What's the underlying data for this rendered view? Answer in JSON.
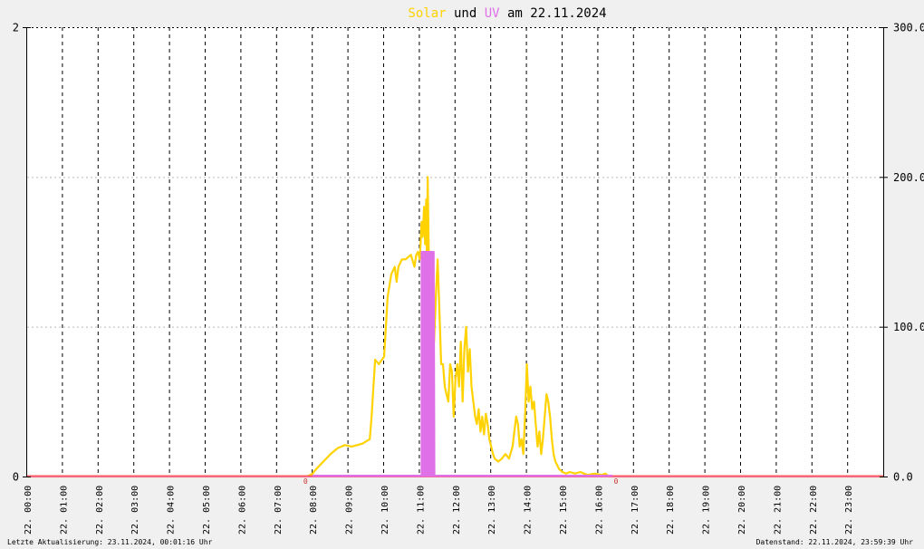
{
  "title": {
    "part1": "Solar",
    "part2": " und ",
    "part3": "UV",
    "part4": " am 22.11.2024"
  },
  "colors": {
    "solar": "#ffd200",
    "uv": "#e070e8",
    "baseline": "#ff6060",
    "title_text": "#000000",
    "background": "#f0f0f0",
    "plot_background": "#ffffff"
  },
  "footer": {
    "left": "Letzte Aktualisierung: 23.11.2024, 00:01:16 Uhr",
    "right": "Datenstand: 22.11.2024, 23:59:39 Uhr"
  },
  "chart_data": {
    "type": "line",
    "x_ticks": [
      "22. 00:00",
      "22. 01:00",
      "22. 02:00",
      "22. 03:00",
      "22. 04:00",
      "22. 05:00",
      "22. 06:00",
      "22. 07:00",
      "22. 08:00",
      "22. 09:00",
      "22. 10:00",
      "22. 11:00",
      "22. 12:00",
      "22. 13:00",
      "22. 14:00",
      "22. 15:00",
      "22. 16:00",
      "22. 17:00",
      "22. 18:00",
      "22. 19:00",
      "22. 20:00",
      "22. 21:00",
      "22. 22:00",
      "22. 23:00"
    ],
    "y_left": {
      "ticks": [
        "0",
        "2"
      ],
      "range": [
        0,
        2
      ]
    },
    "y_right": {
      "ticks": [
        "0.0",
        "100.0",
        "200.0",
        "300.0"
      ],
      "range": [
        0,
        300
      ]
    },
    "grid": true,
    "markers": [
      {
        "label": "0",
        "hour": 7.8
      },
      {
        "label": "0",
        "hour": 16.5
      }
    ],
    "series": [
      {
        "axis": "right",
        "hours": [
          0,
          7.85,
          8.0,
          8.1,
          8.3,
          8.5,
          8.7,
          8.9,
          9.1,
          9.4,
          9.6,
          9.65,
          9.75,
          9.85,
          10.0,
          10.05,
          10.1,
          10.2,
          10.3,
          10.35,
          10.4,
          10.5,
          10.6,
          10.75,
          10.85,
          10.9,
          10.95,
          11.0,
          11.05,
          11.08,
          11.12,
          11.15,
          11.18,
          11.2,
          11.22,
          11.25,
          11.28,
          11.3,
          11.32,
          11.35,
          11.4,
          11.45,
          11.5,
          11.55,
          11.6,
          11.65,
          11.7,
          11.75,
          11.8,
          11.85,
          11.9,
          11.95,
          12.0,
          12.05,
          12.1,
          12.15,
          12.2,
          12.25,
          12.3,
          12.35,
          12.4,
          12.45,
          12.5,
          12.55,
          12.6,
          12.65,
          12.7,
          12.75,
          12.8,
          12.85,
          12.9,
          12.95,
          13.0,
          13.05,
          13.1,
          13.2,
          13.3,
          13.4,
          13.5,
          13.6,
          13.65,
          13.7,
          13.75,
          13.8,
          13.85,
          13.9,
          13.95,
          14.0,
          14.05,
          14.1,
          14.15,
          14.2,
          14.25,
          14.3,
          14.35,
          14.4,
          14.45,
          14.5,
          14.55,
          14.6,
          14.65,
          14.7,
          14.75,
          14.8,
          14.9,
          15.0,
          15.1,
          15.2,
          15.35,
          15.5,
          15.7,
          15.9,
          16.1,
          16.2,
          16.3,
          16.4,
          24
        ],
        "values": [
          0,
          0,
          2,
          5,
          10,
          15,
          19,
          21,
          20,
          22,
          25,
          40,
          78,
          75,
          80,
          100,
          120,
          135,
          140,
          130,
          140,
          145,
          145,
          148,
          140,
          148,
          150,
          145,
          170,
          160,
          180,
          155,
          185,
          140,
          200,
          150,
          100,
          75,
          110,
          100,
          90,
          120,
          145,
          110,
          75,
          75,
          60,
          55,
          50,
          75,
          70,
          40,
          65,
          75,
          60,
          90,
          50,
          85,
          100,
          70,
          85,
          60,
          50,
          40,
          35,
          45,
          30,
          40,
          28,
          42,
          35,
          25,
          20,
          15,
          12,
          10,
          12,
          15,
          12,
          20,
          30,
          40,
          35,
          20,
          25,
          15,
          40,
          75,
          50,
          60,
          45,
          50,
          35,
          20,
          30,
          15,
          25,
          40,
          55,
          50,
          40,
          25,
          15,
          10,
          5,
          3,
          2,
          3,
          2,
          3,
          1,
          2,
          1,
          2,
          0,
          0,
          0
        ]
      },
      {
        "axis": "left",
        "hours": [
          0,
          11.05,
          11.05,
          11.07,
          11.07,
          11.09,
          11.09,
          11.11,
          11.11,
          11.13,
          11.13,
          11.15,
          11.15,
          11.17,
          11.17,
          11.19,
          11.19,
          11.21,
          11.21,
          11.23,
          11.23,
          11.25,
          11.25,
          11.27,
          11.27,
          11.29,
          11.29,
          11.31,
          11.31,
          11.33,
          11.33,
          11.35,
          11.35,
          11.37,
          11.37,
          11.39,
          11.39,
          11.41,
          11.41,
          24
        ],
        "values": [
          0,
          0,
          1,
          0,
          1,
          0,
          1,
          0,
          1,
          0,
          1,
          0,
          1,
          0,
          1,
          0,
          1,
          0,
          1,
          0,
          1,
          0,
          1,
          0,
          1,
          0,
          1,
          0,
          1,
          0,
          1,
          0,
          1,
          0,
          1,
          0,
          1,
          0,
          0,
          0
        ]
      }
    ]
  }
}
